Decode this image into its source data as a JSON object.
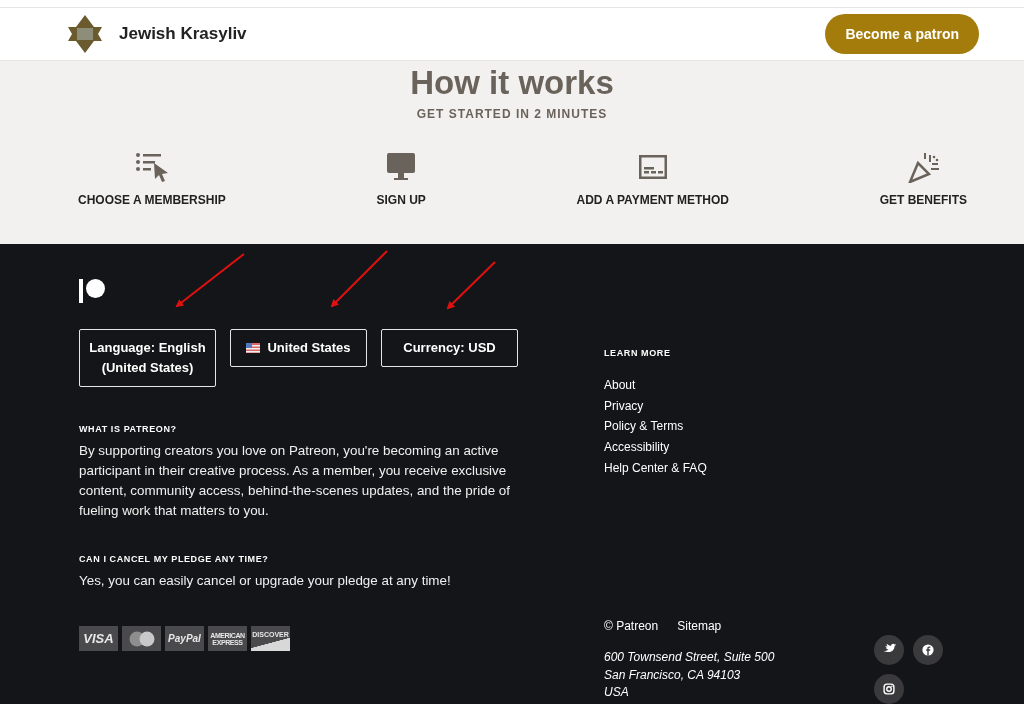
{
  "header": {
    "site_name": "Jewish Krasyliv",
    "cta": "Become a patron"
  },
  "how_it_works": {
    "title": "How it works",
    "subtitle": "GET STARTED IN 2 MINUTES",
    "steps": [
      {
        "kind": "list",
        "label": "CHOOSE A MEMBERSHIP"
      },
      {
        "kind": "monitor",
        "label": "SIGN UP"
      },
      {
        "kind": "card",
        "label": "ADD A PAYMENT METHOD"
      },
      {
        "kind": "party",
        "label": "GET BENEFITS"
      }
    ]
  },
  "footer": {
    "selectors": [
      {
        "kind": "language",
        "label": "Language: English (United States)"
      },
      {
        "kind": "country",
        "label": "United States"
      },
      {
        "kind": "currency",
        "label": "Currency: USD"
      }
    ],
    "faq": [
      {
        "question": "WHAT IS PATREON?",
        "answer": "By supporting creators you love on Patreon, you're becoming an active participant in their creative process. As a member, you receive exclusive content, community access, behind-the-scenes updates, and the pride of fueling work that matters to you."
      },
      {
        "question": "CAN I CANCEL MY PLEDGE ANY TIME?",
        "answer": "Yes, you can easily cancel or upgrade your pledge at any time!"
      }
    ],
    "payment_cards": [
      {
        "kind": "visa",
        "label": "VISA"
      },
      {
        "kind": "mastercard"
      },
      {
        "kind": "paypal",
        "label": "PayPal"
      },
      {
        "kind": "amex",
        "label": "AMERICAN EXPRESS"
      },
      {
        "kind": "discover",
        "label": "DISCOVER"
      }
    ],
    "learn_more": {
      "heading": "LEARN MORE",
      "links": [
        "About",
        "Privacy",
        "Policy & Terms",
        "Accessibility",
        "Help Center & FAQ"
      ]
    },
    "bottom_links": [
      "© Patreon",
      "Sitemap"
    ],
    "address": [
      "600 Townsend Street, Suite 500",
      "San Francisco, CA 94103",
      "USA"
    ],
    "social": [
      {
        "kind": "twitter"
      },
      {
        "kind": "facebook"
      },
      {
        "kind": "instagram"
      }
    ]
  }
}
